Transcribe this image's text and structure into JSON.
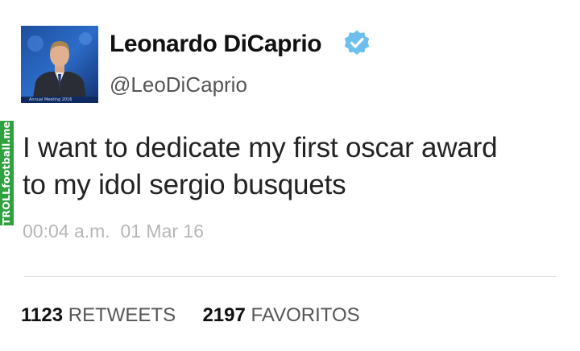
{
  "watermark": "TROLLfootball.me",
  "user": {
    "display_name": "Leonardo DiCaprio",
    "handle": "@LeoDiCaprio",
    "verified_icon": "verified-badge-icon",
    "avatar_caption": "Annual Meeting 2016"
  },
  "tweet": {
    "lines": [
      "I want to dedicate my first oscar award",
      "to my idol sergio busquets"
    ],
    "timestamp": "00:04 a.m.  01 Mar 16"
  },
  "stats": {
    "retweets_count": "1123",
    "retweets_label": "RETWEETS",
    "favorites_count": "2197",
    "favorites_label": "FAVORITOS"
  },
  "colors": {
    "verified": "#6dbfee",
    "watermark_bg": "#2fa13e",
    "timestamp": "#b6b6b6",
    "label": "#555555"
  }
}
